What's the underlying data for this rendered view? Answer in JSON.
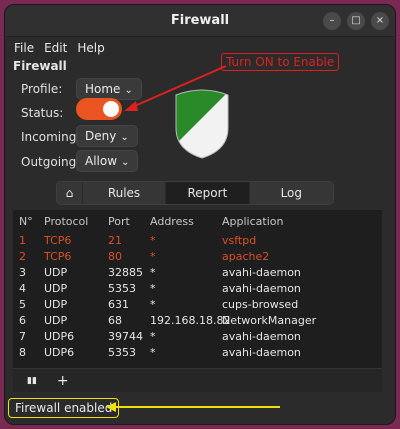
{
  "window": {
    "title": "Firewall",
    "controls": {
      "minimize": "–",
      "maximize": "□",
      "close": "×"
    }
  },
  "menu": [
    "File",
    "Edit",
    "Help"
  ],
  "panel": {
    "title": "Firewall",
    "profile": {
      "label": "Profile:",
      "value": "Home"
    },
    "status": {
      "label": "Status:",
      "enabled": true
    },
    "incoming": {
      "label": "Incoming:",
      "value": "Deny"
    },
    "outgoing": {
      "label": "Outgoing:",
      "value": "Allow"
    }
  },
  "annotations": {
    "turn_on": "Turn ON to Enable",
    "turn_on_color": "#e02020",
    "status_color": "#f0e010"
  },
  "tabs": {
    "home_icon": "home-icon",
    "items": [
      "Rules",
      "Report",
      "Log"
    ],
    "active": "Report"
  },
  "table": {
    "headers": [
      "N°",
      "Protocol",
      "Port",
      "Address",
      "Application"
    ],
    "rows": [
      {
        "n": "1",
        "protocol": "TCP6",
        "port": "21",
        "address": "*",
        "app": "vsftpd",
        "deny": true
      },
      {
        "n": "2",
        "protocol": "TCP6",
        "port": "80",
        "address": "*",
        "app": "apache2",
        "deny": true
      },
      {
        "n": "3",
        "protocol": "UDP",
        "port": "32885",
        "address": "*",
        "app": "avahi-daemon",
        "deny": false
      },
      {
        "n": "4",
        "protocol": "UDP",
        "port": "5353",
        "address": "*",
        "app": "avahi-daemon",
        "deny": false
      },
      {
        "n": "5",
        "protocol": "UDP",
        "port": "631",
        "address": "*",
        "app": "cups-browsed",
        "deny": false
      },
      {
        "n": "6",
        "protocol": "UDP",
        "port": "68",
        "address": "192.168.18.82",
        "app": "NetworkManager",
        "deny": false
      },
      {
        "n": "7",
        "protocol": "UDP6",
        "port": "39744",
        "address": "*",
        "app": "avahi-daemon",
        "deny": false
      },
      {
        "n": "8",
        "protocol": "UDP6",
        "port": "5353",
        "address": "*",
        "app": "avahi-daemon",
        "deny": false
      }
    ]
  },
  "tools": {
    "pause": "▮▮",
    "add": "+"
  },
  "status_text": "Firewall enabled",
  "colors": {
    "accent": "#e95420",
    "deny_row": "#d9502a"
  }
}
